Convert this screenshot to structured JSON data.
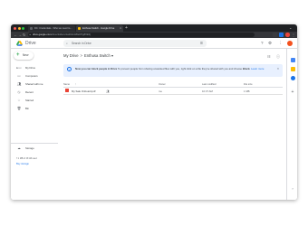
{
  "browser": {
    "tabs": [
      {
        "title": "DC: Credentials - Who we need to..."
      },
      {
        "title": "Enthusa Switch - Google Drive"
      }
    ],
    "new_tab_symbol": "+",
    "url_host": "drive.google.com",
    "url_path": "/drive/folders/1a2b3c4d5e6f7g8h9i0j"
  },
  "drive": {
    "brand": "Drive",
    "search_placeholder": "Search in Drive",
    "new_label": "New",
    "nav": [
      {
        "label": "My Drive",
        "icon": "my-drive-icon"
      },
      {
        "label": "Computers",
        "icon": "computer-icon"
      },
      {
        "label": "Shared with me",
        "icon": "people-icon"
      },
      {
        "label": "Recent",
        "icon": "clock-icon"
      },
      {
        "label": "Starred",
        "icon": "star-icon"
      },
      {
        "label": "Bin",
        "icon": "trash-icon"
      },
      {
        "label": "Storage",
        "icon": "cloud-icon"
      }
    ],
    "storage_text": "7.1 MB of 15 GB used",
    "storage_link": "Buy storage",
    "breadcrumb": {
      "root": "My Drive",
      "separator": ">",
      "current": "Enthusa Switch",
      "chevron": "▾"
    },
    "banner": {
      "bold": "Now you can block people in Drive",
      "text": "To prevent people from sharing unwanted files with you, right click on a file they've shared with you and choose",
      "bold2": "Block.",
      "link": "Learn more"
    },
    "columns": {
      "name": "Name",
      "owner": "Owner",
      "modified": "Last modified",
      "size": "File size"
    },
    "files": [
      {
        "name": "My Sale Onboard.pdf",
        "owner": "me",
        "modified": "10:37 AM",
        "size": "1 MB"
      }
    ]
  },
  "colors": {
    "accent": "#1a73e8",
    "banner_bg": "#e8f0fe",
    "avatar": "#f4511e",
    "pdf": "#ea4335"
  }
}
